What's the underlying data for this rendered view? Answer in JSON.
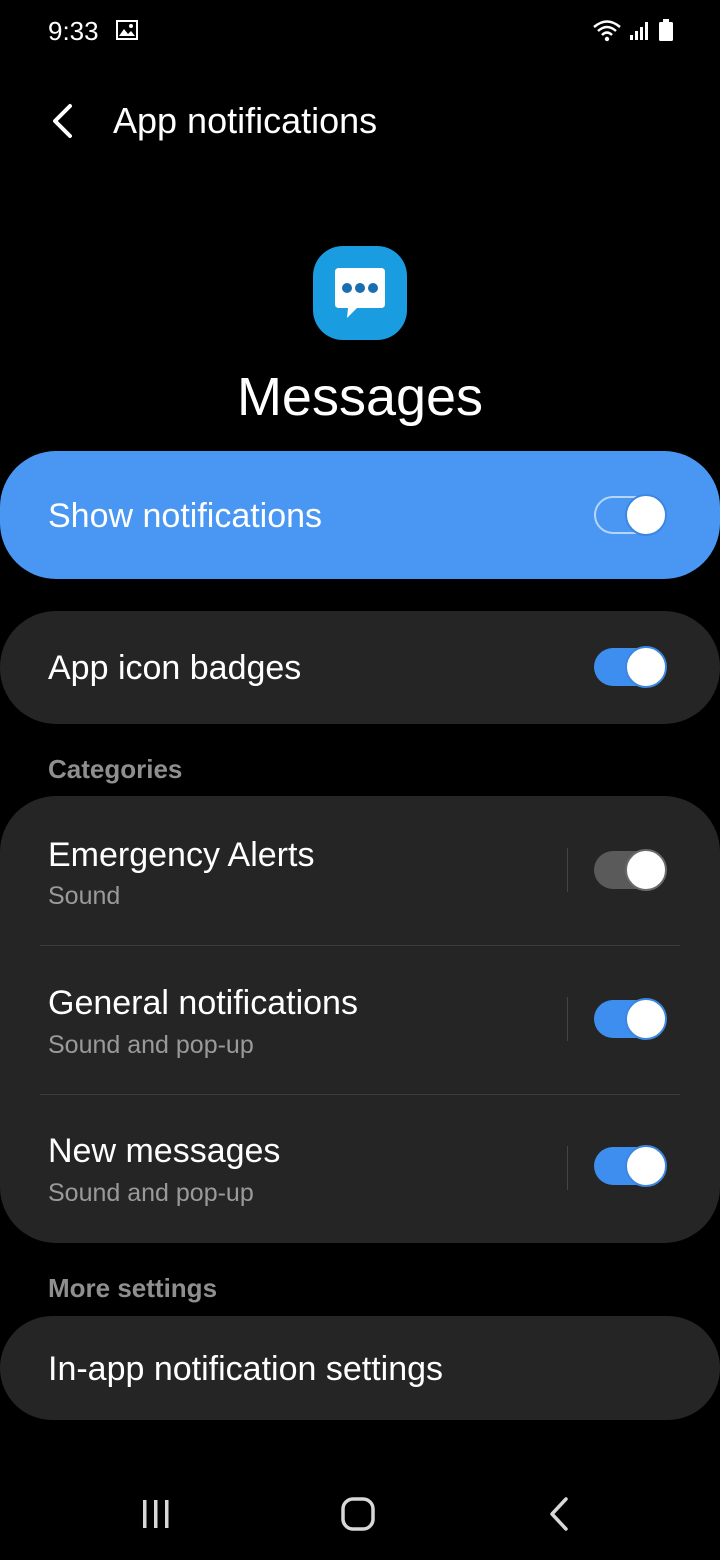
{
  "status_bar": {
    "time": "9:33",
    "icons": [
      "gallery-icon",
      "wifi-icon",
      "signal-icon",
      "battery-icon"
    ]
  },
  "header": {
    "title": "App notifications",
    "back_icon": "chevron-left-icon"
  },
  "app": {
    "name": "Messages",
    "icon": "chat-bubble-icon",
    "icon_color": "#1a9ce0"
  },
  "show_notifications": {
    "label": "Show notifications",
    "enabled": true
  },
  "app_icon_badges": {
    "label": "App icon badges",
    "enabled": true
  },
  "categories": {
    "label": "Categories",
    "items": [
      {
        "label": "Emergency Alerts",
        "sub": "Sound",
        "enabled": false
      },
      {
        "label": "General notifications",
        "sub": "Sound and pop-up",
        "enabled": true
      },
      {
        "label": "New messages",
        "sub": "Sound and pop-up",
        "enabled": true
      }
    ]
  },
  "more_settings": {
    "label": "More settings",
    "items": [
      {
        "label": "In-app notification settings"
      }
    ]
  },
  "nav_bar": {
    "items": [
      "recents-icon",
      "home-icon",
      "back-icon"
    ]
  },
  "colors": {
    "accent": "#4a97f3",
    "toggle_on": "#3e8ef0",
    "card": "#252525",
    "background": "#000000"
  }
}
